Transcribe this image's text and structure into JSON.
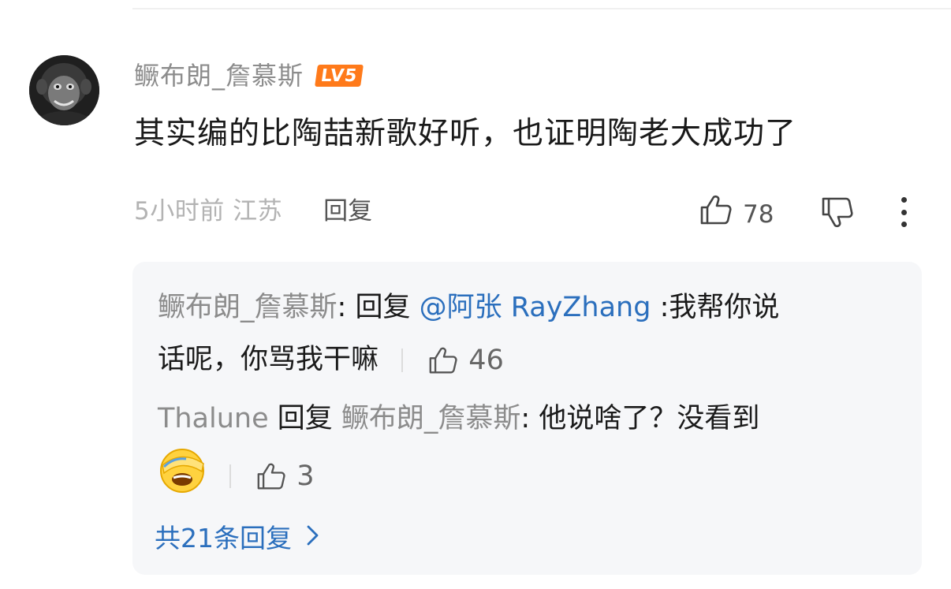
{
  "comment": {
    "username": "鳜布朗_詹慕斯",
    "level": "LV5",
    "text": "其实编的比陶喆新歌好听，也证明陶老大成功了",
    "time_location": "5小时前 江苏",
    "reply_label": "回复",
    "like_count": "78",
    "icons": [
      "avatar-image",
      "thumbs-up-icon",
      "thumbs-down-icon",
      "more-vertical-icon"
    ]
  },
  "replies": [
    {
      "author": "鳜布朗_詹慕斯",
      "sep": ": ",
      "reply_word": "回复",
      "mention": "@阿张 RayZhang",
      "text_part1": " :我帮你说",
      "text_part2": "话呢，你骂我干嘛",
      "like_count": "46"
    },
    {
      "author": "Thalune",
      "reply_word": " 回复 ",
      "target": "鳜布朗_詹慕斯",
      "text": ": 他说啥了？没看到",
      "emoji": "facepalm-emoji",
      "like_count": "3"
    }
  ],
  "total_replies": "共21条回复",
  "colors": {
    "accent_blue": "#2b6fbd",
    "muted_gray": "#8c8c8c",
    "level_orange": "#ff7a1a",
    "reply_bg": "#f6f7f9"
  }
}
